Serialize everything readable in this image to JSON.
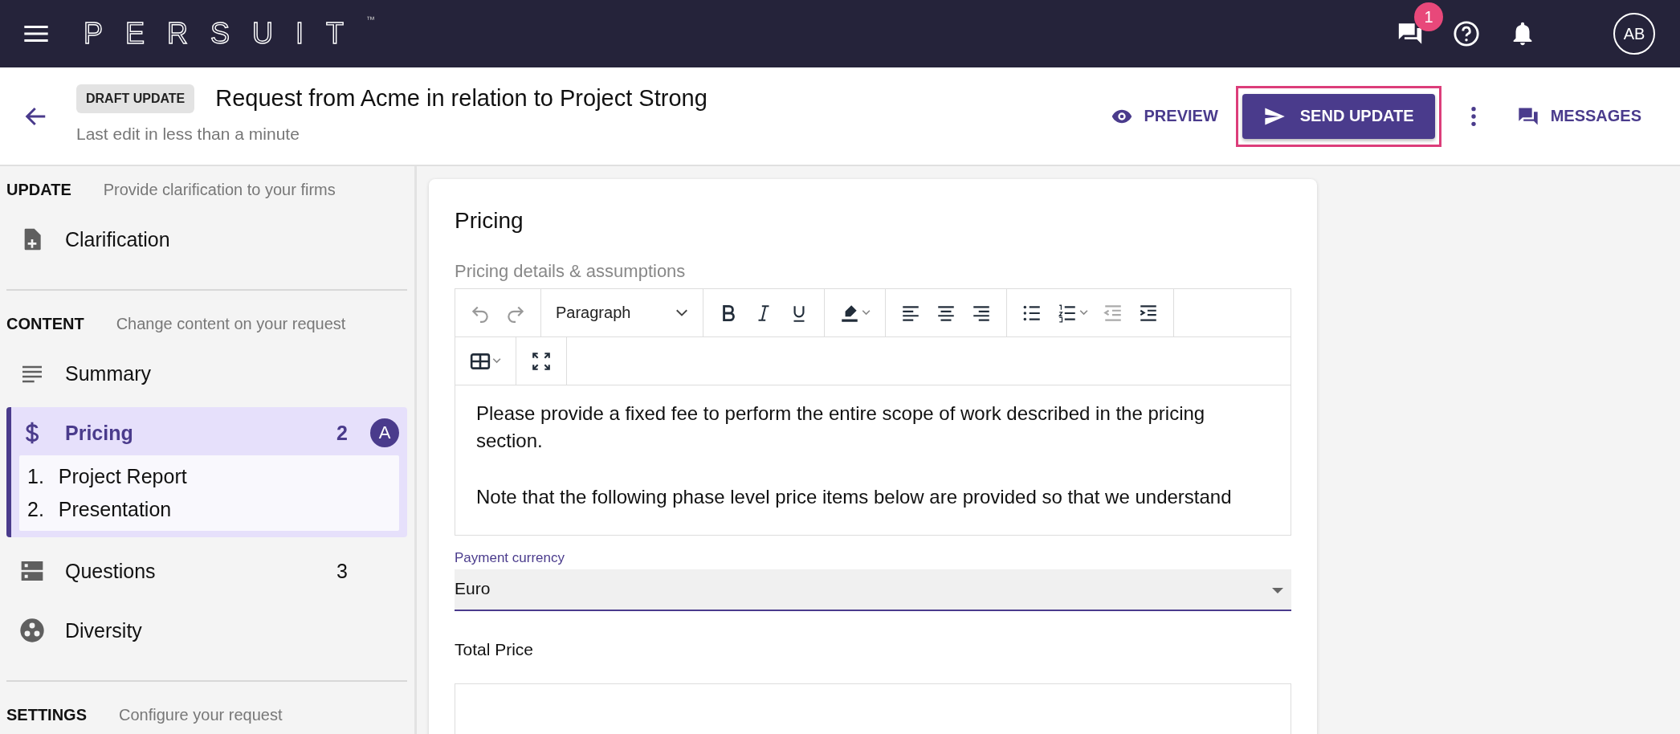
{
  "topbar": {
    "logo": "PERSUIT",
    "logo_mark": "™",
    "messages_badge": "1",
    "avatar": "AB"
  },
  "header": {
    "badge": "DRAFT UPDATE",
    "title": "Request from Acme in relation to Project Strong",
    "subtitle": "Last edit in less than a minute",
    "actions": [
      {
        "kind": "preview",
        "label": "PREVIEW",
        "highlighted": false
      },
      {
        "kind": "send",
        "label": "SEND UPDATE",
        "highlighted": true
      },
      {
        "kind": "more",
        "highlighted": false
      },
      {
        "kind": "messages",
        "label": "MESSAGES",
        "highlighted": false
      }
    ]
  },
  "sidebar": {
    "sections": [
      {
        "heading": "UPDATE",
        "hint": "Provide clarification to your firms",
        "items": [
          {
            "kind": "file-plus",
            "label": "Clarification",
            "selected": false
          }
        ]
      },
      {
        "heading": "CONTENT",
        "hint": "Change content on your request",
        "items": [
          {
            "kind": "lines",
            "label": "Summary",
            "selected": false
          },
          {
            "kind": "dollar",
            "label": "Pricing",
            "count": "2",
            "avatar": "A",
            "selected": true,
            "children": [
              {
                "number": "1.",
                "label": "Project Report"
              },
              {
                "number": "2.",
                "label": "Presentation"
              }
            ]
          },
          {
            "kind": "storage",
            "label": "Questions",
            "count": "3",
            "selected": false
          },
          {
            "kind": "diversity",
            "label": "Diversity",
            "selected": false
          }
        ]
      },
      {
        "heading": "SETTINGS",
        "hint": "Configure your request"
      }
    ]
  },
  "card": {
    "title": "Pricing",
    "editor_label": "Pricing details & assumptions",
    "block_format": "Paragraph",
    "paragraphs": [
      "Please provide a fixed fee to perform the entire scope of work described in the pricing section.",
      "Note that the following phase level price items below are provided so that we understand"
    ],
    "currency": {
      "label": "Payment currency",
      "value": "Euro"
    },
    "total_label": "Total Price"
  }
}
